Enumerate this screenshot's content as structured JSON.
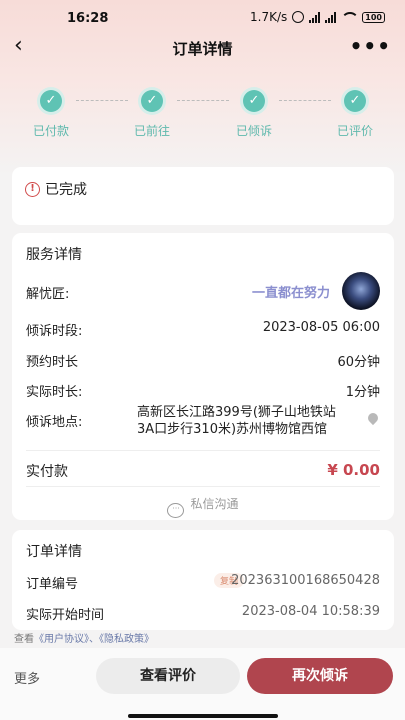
{
  "status_bar": {
    "time": "16:28",
    "speed": "1.7K/s",
    "battery": "100",
    "icons": [
      "alarm-icon",
      "signal-icon",
      "signal-icon",
      "wifi-icon",
      "battery-icon"
    ]
  },
  "nav": {
    "back_icon": "‹",
    "title": "订单详情",
    "more_icon": "•••"
  },
  "steps": [
    {
      "label": "已付款",
      "check": "✓"
    },
    {
      "label": "已前往",
      "check": "✓"
    },
    {
      "label": "已倾诉",
      "check": "✓"
    },
    {
      "label": "已评价",
      "check": "✓"
    }
  ],
  "status_card": {
    "icon": "!",
    "text": "已完成"
  },
  "service": {
    "title": "服务详情",
    "helper_label": "解忧匠:",
    "helper_name": "一直都在努力",
    "time_label": "倾诉时段:",
    "time_value": "2023-08-05 06:00",
    "booked_label": "预约时长",
    "booked_value": "60分钟",
    "actual_label": "实际时长:",
    "actual_value": "1分钟",
    "place_label": "倾诉地点:",
    "place_value": "高新区长江路399号(狮子山地铁站3A口步行310米)苏州博物馆西馆",
    "paid_label": "实付款",
    "paid_value": "¥ 0.00",
    "chat_label": "私信沟通",
    "chat_icon": "···"
  },
  "order": {
    "title": "订单详情",
    "number_label": "订单编号",
    "copy_label": "复制",
    "number_value": "202363100168650428",
    "start_label": "实际开始时间",
    "start_value": "2023-08-04 10:58:39"
  },
  "agreement": {
    "prefix": "查看",
    "user_agreement": "《用户协议》",
    "sep": "、",
    "privacy": "《隐私政策》"
  },
  "bottom": {
    "more": "更多",
    "review": "查看评价",
    "again": "再次倾诉"
  },
  "colors": {
    "accent": "#b0454e",
    "step": "#5fc3b4",
    "price": "#c74750"
  }
}
